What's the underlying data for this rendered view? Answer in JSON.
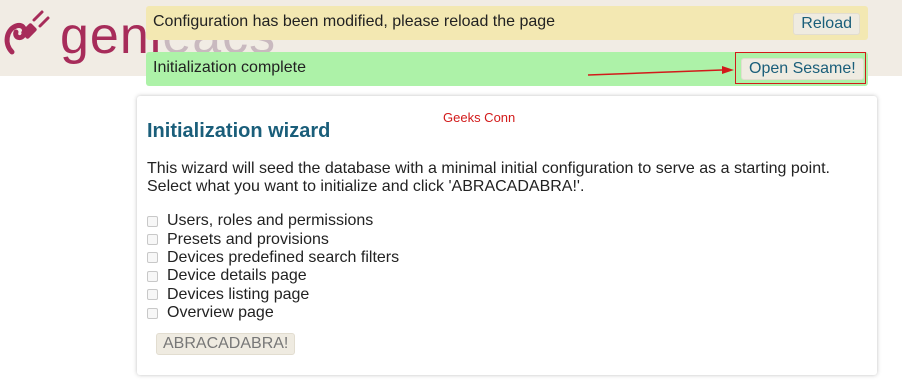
{
  "header": {
    "logo_text_main": "geni",
    "logo_text_faded": "eacs"
  },
  "notices": {
    "config_modified": {
      "message": "Configuration has been modified, please reload the page",
      "button_label": "Reload"
    },
    "init_complete": {
      "message": "Initialization complete",
      "button_label": "Open Sesame!"
    }
  },
  "wizard": {
    "watermark": "Geeks Conn",
    "title": "Initialization wizard",
    "intro_line1": "This wizard will seed the database with a minimal initial configuration to serve as a starting point.",
    "intro_line2": "Select what you want to initialize and click 'ABRACADABRA!'.",
    "options": [
      {
        "label": "Users, roles and permissions",
        "checked": false
      },
      {
        "label": "Presets and provisions",
        "checked": false
      },
      {
        "label": "Devices predefined search filters",
        "checked": false
      },
      {
        "label": "Device details page",
        "checked": false
      },
      {
        "label": "Devices listing page",
        "checked": false
      },
      {
        "label": "Overview page",
        "checked": false
      }
    ],
    "submit_label": "ABRACADABRA!"
  },
  "colors": {
    "brand": "#a72c5a",
    "link": "#1a5e7a",
    "warn_bg": "#f3e8b2",
    "ok_bg": "#adf2a8",
    "annotation": "#d21a1a"
  }
}
